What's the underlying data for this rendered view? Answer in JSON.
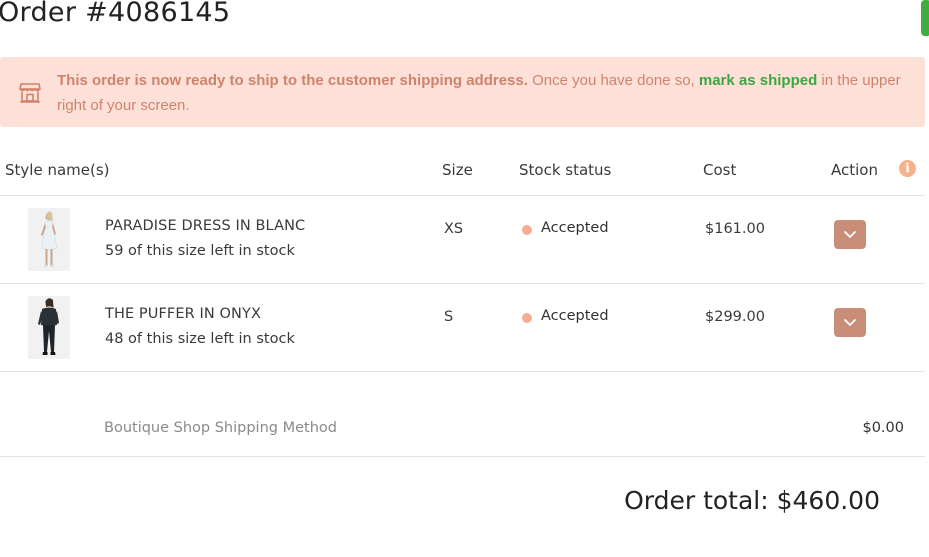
{
  "order": {
    "title": "Order #4086145"
  },
  "banner": {
    "bold_text": "This order is now ready to ship to the customer shipping address.",
    "text_before_link": " Once you have done so, ",
    "link_text": "mark as shipped",
    "text_after_link": " in the upper right of your screen.",
    "icon": "store-icon"
  },
  "table": {
    "headers": {
      "style": "Style name(s)",
      "size": "Size",
      "stock": "Stock status",
      "cost": "Cost",
      "action": "Action"
    },
    "info_icon": "i",
    "rows": [
      {
        "name": "PARADISE DRESS IN BLANC",
        "stock_left": "59 of this size left in stock",
        "size": "XS",
        "status": "Accepted",
        "cost": "$161.00"
      },
      {
        "name": "THE PUFFER IN ONYX",
        "stock_left": "48 of this size left in stock",
        "size": "S",
        "status": "Accepted",
        "cost": "$299.00"
      }
    ]
  },
  "shipping": {
    "method": "Boutique Shop Shipping Method",
    "cost": "$0.00"
  },
  "total": {
    "text": "Order total: $460.00"
  },
  "colors": {
    "banner_bg": "#fde1d9",
    "banner_text": "#d0836b",
    "link_green": "#3ea641",
    "action_button": "#c98e77",
    "status_dot": "#f6ab95"
  }
}
